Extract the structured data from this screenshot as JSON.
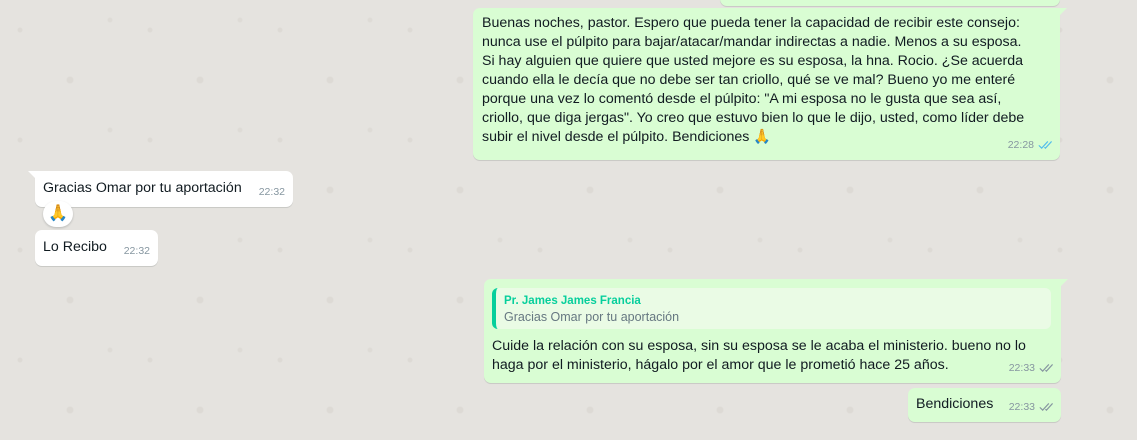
{
  "messages": {
    "m1": {
      "text": "Buenas noches, pastor. Espero que pueda tener la capacidad de recibir este consejo: nunca use el púlpito para bajar/atacar/mandar indirectas a nadie. Menos a su esposa. Si hay alguien que quiere que usted mejore es su esposa, la hna. Rocio. ¿Se acuerda cuando ella le decía que no debe ser tan criollo, qué se ve mal? Bueno yo me enteré porque una vez lo comentó desde el púlpito: \"A mi esposa no le gusta que sea así, criollo, que diga jergas\". Yo creo que estuvo bien lo que le dijo, usted, como líder debe subir el nivel desde el púlpito. Bendiciones 🙏",
      "time": "22:28",
      "status": "read"
    },
    "m2": {
      "text": "Gracias Omar por tu aportación",
      "time": "22:32",
      "reaction": "🙏"
    },
    "m3": {
      "text": "Lo Recibo",
      "time": "22:32"
    },
    "m4": {
      "quote_author": "Pr. James James Francia",
      "quote_text": "Gracias Omar por tu aportación",
      "text": "Cuide la relación con su esposa, sin su esposa se le acaba el ministerio. bueno no lo haga por el ministerio, hágalo por el amor que le prometió hace 25 años.",
      "time": "22:33",
      "status": "delivered"
    },
    "m5": {
      "text": "Bendiciones",
      "time": "22:33",
      "status": "delivered"
    }
  },
  "colors": {
    "outgoing_bubble": "#d9fdd3",
    "incoming_bubble": "#ffffff",
    "read_tick": "#53bdeb",
    "quote_accent": "#06cf9c"
  }
}
